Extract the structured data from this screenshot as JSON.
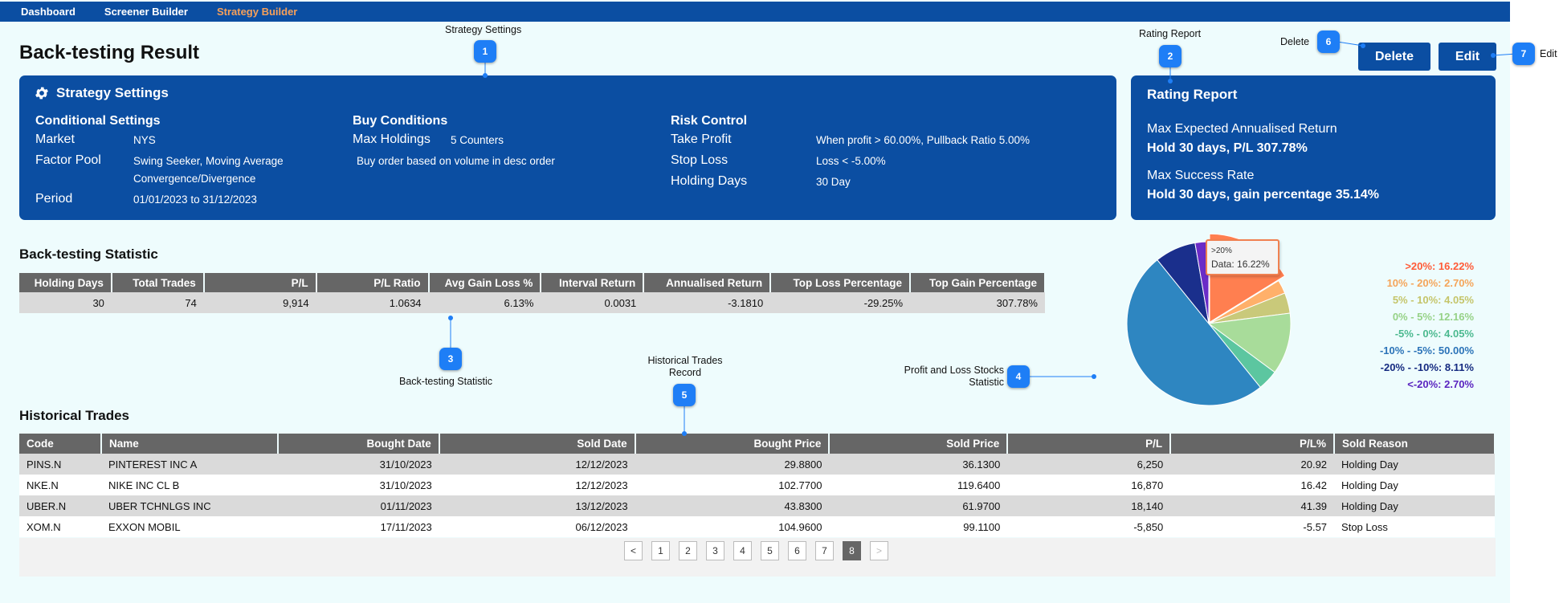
{
  "nav": {
    "items": [
      {
        "label": "Dashboard",
        "active": false
      },
      {
        "label": "Screener Builder",
        "active": false
      },
      {
        "label": "Strategy Builder",
        "active": true
      }
    ]
  },
  "page_title": "Back-testing Result",
  "actions": {
    "delete_label": "Delete",
    "edit_label": "Edit"
  },
  "strategy_settings": {
    "title": "Strategy Settings",
    "conditional": {
      "heading": "Conditional Settings",
      "market_label": "Market",
      "market_value": "NYS",
      "factor_label": "Factor Pool",
      "factor_value": "Swing Seeker, Moving Average Convergence/Divergence",
      "period_label": "Period",
      "period_value": "01/01/2023 to 31/12/2023"
    },
    "buy": {
      "heading": "Buy Conditions",
      "max_holdings_label": "Max Holdings",
      "max_holdings_value": "5 Counters",
      "order_note": "Buy order based on volume in desc order"
    },
    "risk": {
      "heading": "Risk Control",
      "take_profit_label": "Take Profit",
      "take_profit_value": "When profit > 60.00%, Pullback Ratio 5.00%",
      "stop_loss_label": "Stop Loss",
      "stop_loss_value": "Loss < -5.00%",
      "holding_days_label": "Holding Days",
      "holding_days_value": "30 Day"
    }
  },
  "rating_report": {
    "title": "Rating Report",
    "ret_label": "Max Expected Annualised Return",
    "ret_value": "Hold 30 days, P/L 307.78%",
    "succ_label": "Max Success Rate",
    "succ_value": "Hold 30 days, gain percentage 35.14%"
  },
  "statistic": {
    "heading": "Back-testing Statistic",
    "columns": [
      "Holding Days",
      "Total Trades",
      "P/L",
      "P/L Ratio",
      "Avg Gain Loss %",
      "Interval Return",
      "Annualised Return",
      "Top Loss Percentage",
      "Top Gain Percentage"
    ],
    "row": [
      "30",
      "74",
      "9,914",
      "1.0634",
      "6.13%",
      "0.0031",
      "-3.1810",
      "-29.25%",
      "307.78%"
    ]
  },
  "trades": {
    "heading": "Historical Trades",
    "columns": [
      "Code",
      "Name",
      "Bought Date",
      "Sold Date",
      "Bought Price",
      "Sold Price",
      "P/L",
      "P/L%",
      "Sold Reason"
    ],
    "rows": [
      [
        "PINS.N",
        "PINTEREST INC A",
        "31/10/2023",
        "12/12/2023",
        "29.8800",
        "36.1300",
        "6,250",
        "20.92",
        "Holding Day"
      ],
      [
        "NKE.N",
        "NIKE INC CL B",
        "31/10/2023",
        "12/12/2023",
        "102.7700",
        "119.6400",
        "16,870",
        "16.42",
        "Holding Day"
      ],
      [
        "UBER.N",
        "UBER TCHNLGS INC",
        "01/11/2023",
        "13/12/2023",
        "43.8300",
        "61.9700",
        "18,140",
        "41.39",
        "Holding Day"
      ],
      [
        "XOM.N",
        "EXXON MOBIL",
        "17/11/2023",
        "06/12/2023",
        "104.9600",
        "99.1100",
        "-5,850",
        "-5.57",
        "Stop Loss"
      ]
    ],
    "pager": {
      "prev": "<",
      "pages": [
        "1",
        "2",
        "3",
        "4",
        "5",
        "6",
        "7",
        "8"
      ],
      "current": "8",
      "next": ">"
    }
  },
  "annotations": {
    "m1": {
      "num": "1",
      "text": "Strategy Settings"
    },
    "m2": {
      "num": "2",
      "text": "Rating Report"
    },
    "m3": {
      "num": "3",
      "text": "Back-testing Statistic"
    },
    "m4": {
      "num": "4",
      "text_line1": "Profit and Loss Stocks",
      "text_line2": "Statistic"
    },
    "m5": {
      "num": "5",
      "text_line1": "Historical Trades",
      "text_line2": "Record"
    },
    "m6": {
      "num": "6",
      "text": "Delete"
    },
    "m7": {
      "num": "7",
      "text": "Edit"
    }
  },
  "tooltip": {
    "label": ">20%",
    "value": "Data: 16.22%"
  },
  "chart_data": {
    "type": "pie",
    "slices": [
      {
        "label": ">20%",
        "value": 16.22,
        "color": "#ff7f50"
      },
      {
        "label": "10% - 20%",
        "value": 2.7,
        "color": "#ffb06a"
      },
      {
        "label": "5% - 10%",
        "value": 4.05,
        "color": "#c9c97a"
      },
      {
        "label": "0% - 5%",
        "value": 12.16,
        "color": "#a8dc9a"
      },
      {
        "label": "-5% - 0%",
        "value": 4.05,
        "color": "#5cc6a0"
      },
      {
        "label": "-10% - -5%",
        "value": 50.0,
        "color": "#2e86c1"
      },
      {
        "label": "-20% - -10%",
        "value": 8.11,
        "color": "#1a2f8c"
      },
      {
        "label": "<-20%",
        "value": 2.7,
        "color": "#6a2cc7"
      }
    ],
    "legend": [
      {
        "label": ">20%:",
        "value": "16.22%",
        "color": "#ff5a36"
      },
      {
        "label": "10% - 20%:",
        "value": "2.70%",
        "color": "#f5a55a"
      },
      {
        "label": "5% - 10%:",
        "value": "4.05%",
        "color": "#c5c56a"
      },
      {
        "label": "0% - 5%:",
        "value": "12.16%",
        "color": "#96d287"
      },
      {
        "label": "-5% - 0%:",
        "value": "4.05%",
        "color": "#4bb98f"
      },
      {
        "label": "-10% - -5%:",
        "value": "50.00%",
        "color": "#2b73b8"
      },
      {
        "label": "-20% - -10%:",
        "value": "8.11%",
        "color": "#142a80"
      },
      {
        "label": "<-20%:",
        "value": "2.70%",
        "color": "#5a24c0"
      }
    ],
    "legend_placement": "right"
  }
}
